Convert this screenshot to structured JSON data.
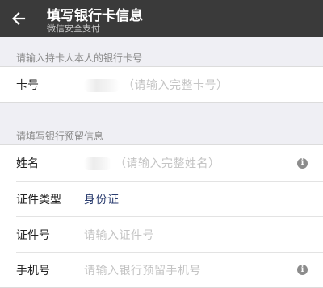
{
  "header": {
    "title": "填写银行卡信息",
    "subtitle": "微信安全支付",
    "back_icon": "back-arrow-icon"
  },
  "card_section": {
    "label": "请输入持卡人本人的银行卡号",
    "row": {
      "label": "卡号",
      "placeholder": "（请输入完整卡号）"
    }
  },
  "info_section": {
    "label": "请填写银行预留信息",
    "rows": [
      {
        "label": "姓名",
        "placeholder": "（请输入完整姓名）",
        "icon": "info-icon"
      },
      {
        "label": "证件类型",
        "value": "身份证"
      },
      {
        "label": "证件号",
        "placeholder": "请输入证件号"
      },
      {
        "label": "手机号",
        "placeholder": "请输入银行预留手机号",
        "icon": "info-icon"
      }
    ]
  },
  "colors": {
    "titlebar": "#3a3a3a",
    "background": "#efeff4",
    "value_text": "#2c3e70",
    "placeholder_text": "#c4c4c4"
  }
}
